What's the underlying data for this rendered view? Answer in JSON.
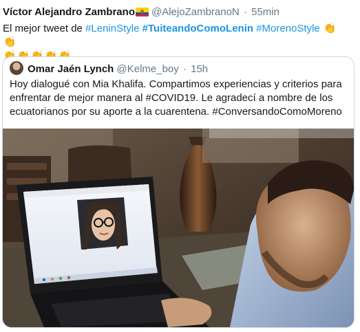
{
  "tweet": {
    "author_name": "Víctor Alejandro Zambrano",
    "author_flag": "ecuador-flag-emoji",
    "handle": "@AlejoZambranoN",
    "separator": "·",
    "time": "55min",
    "text_lead": "El mejor tweet de",
    "hashtags": [
      "#LeninStyle",
      "#TuiteandoComoLenin",
      "#MorenoStyle"
    ],
    "claps": [
      "👏",
      "👏",
      "👏",
      "👏",
      "👏",
      "👏",
      "👏"
    ]
  },
  "quoted": {
    "author_name": "Omar Jaén Lynch",
    "handle": "@Kelme_boy",
    "separator": "·",
    "time": "15h",
    "text": "Hoy dialogué con Mia Khalifa. Compartimos experiencias y criterios para enfrentar de mejor manera al #COVID19. Le agradecí a nombre de los ecuatorianos por su aporte a la cuarentena. #ConversandoComoMoreno",
    "image": "photo of man looking at laptop video call with woman wearing glasses"
  },
  "colors": {
    "text": "#14171a",
    "muted": "#657786",
    "link": "#1b95e0",
    "border": "#ccd6dd"
  }
}
